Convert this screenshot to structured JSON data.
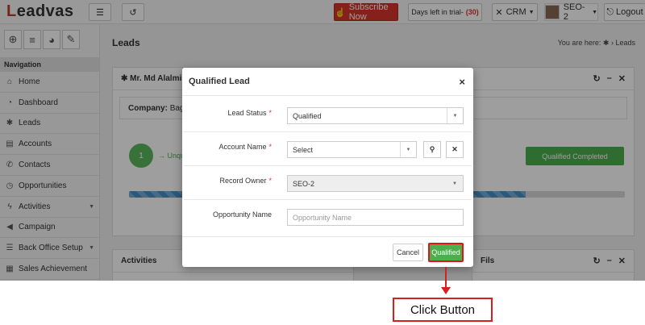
{
  "topbar": {
    "logo": "Leadvas",
    "subscribe_label": "Subscribe Now",
    "trial_label": "Days left in trial-",
    "trial_count": "(30)",
    "crm_label": "CRM",
    "user_label": "SEO-2",
    "logout_label": "Logout"
  },
  "sidebar": {
    "heading": "Navigation",
    "items": [
      {
        "label": "Home",
        "icon": "home-icon",
        "glyph": "⌂"
      },
      {
        "label": "Dashboard",
        "icon": "dashboard-icon",
        "glyph": "◔"
      },
      {
        "label": "Leads",
        "icon": "person-icon",
        "glyph": "✱"
      },
      {
        "label": "Accounts",
        "icon": "book-icon",
        "glyph": "▤"
      },
      {
        "label": "Contacts",
        "icon": "phone-icon",
        "glyph": "✆"
      },
      {
        "label": "Opportunities",
        "icon": "clock-icon",
        "glyph": "◷"
      },
      {
        "label": "Activities",
        "icon": "bolt-icon",
        "glyph": "ϟ"
      },
      {
        "label": "Campaign",
        "icon": "megaphone-icon",
        "glyph": "◀"
      },
      {
        "label": "Back Office Setup",
        "icon": "sliders-icon",
        "glyph": "☰"
      },
      {
        "label": "Sales Achievement",
        "icon": "list-icon",
        "glyph": "▦"
      }
    ]
  },
  "main": {
    "page_title": "Leads",
    "breadcrumb_prefix": "You are here:",
    "breadcrumb_current": "Leads",
    "lead_name": "Mr. Md Alalmin",
    "company_label": "Company:",
    "company_value": "Bag p",
    "step_number": "1",
    "step_label": "Unquali",
    "completed_label": "Qualified Completed",
    "progress_fraction": 0.8,
    "activities_title": "Activities",
    "files_title": "Fils"
  },
  "modal": {
    "title": "Qualified Lead",
    "fields": [
      {
        "label": "Lead Status",
        "required": "*",
        "value": "Qualified"
      },
      {
        "label": "Account Name",
        "required": "*",
        "value": "Select"
      },
      {
        "label": "Record Owner",
        "required": "*",
        "value": "SEO-2"
      },
      {
        "label": "Opportunity Name",
        "required": "",
        "placeholder": "Opportunity Name"
      }
    ],
    "cancel_label": "Cancel",
    "qualified_label": "Qualified"
  },
  "annotation": {
    "callout": "Click Button",
    "color": "#d62020"
  },
  "colors": {
    "brand_red": "#d9342b",
    "success_green": "#4cae4c",
    "progress_blue": "#4a90c4"
  }
}
